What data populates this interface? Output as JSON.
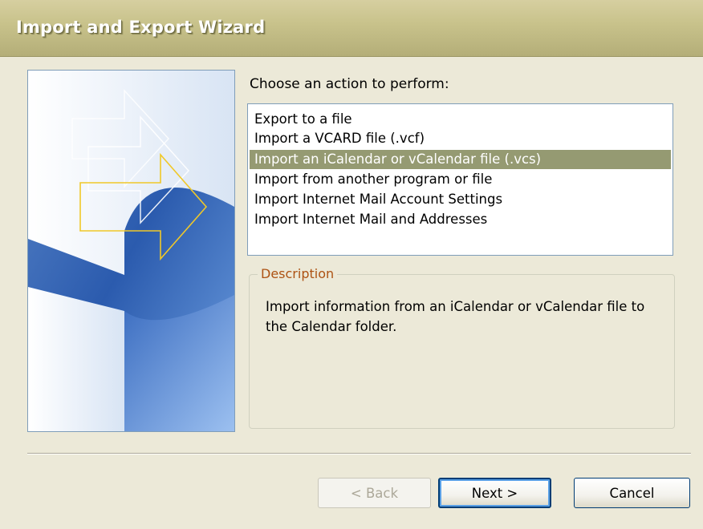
{
  "window": {
    "title": "Import and Export Wizard"
  },
  "prompt": {
    "label": "Choose an action to perform:"
  },
  "actions": {
    "items": [
      {
        "label": "Export to a file",
        "selected": false
      },
      {
        "label": "Import a VCARD file (.vcf)",
        "selected": false
      },
      {
        "label": "Import an iCalendar or vCalendar file (.vcs)",
        "selected": true
      },
      {
        "label": "Import from another program or file",
        "selected": false
      },
      {
        "label": "Import Internet Mail Account Settings",
        "selected": false
      },
      {
        "label": "Import Internet Mail and Addresses",
        "selected": false
      }
    ]
  },
  "description": {
    "legend": "Description",
    "text": "Import information from an iCalendar or vCalendar file to the Calendar folder."
  },
  "buttons": {
    "back": "< Back",
    "next": "Next >",
    "cancel": "Cancel"
  },
  "colors": {
    "selection": "#959a72",
    "legend": "#ad5213",
    "dialog_bg": "#ece9d8"
  },
  "icons": {
    "side_art": "wizard-arrows-graphic"
  }
}
